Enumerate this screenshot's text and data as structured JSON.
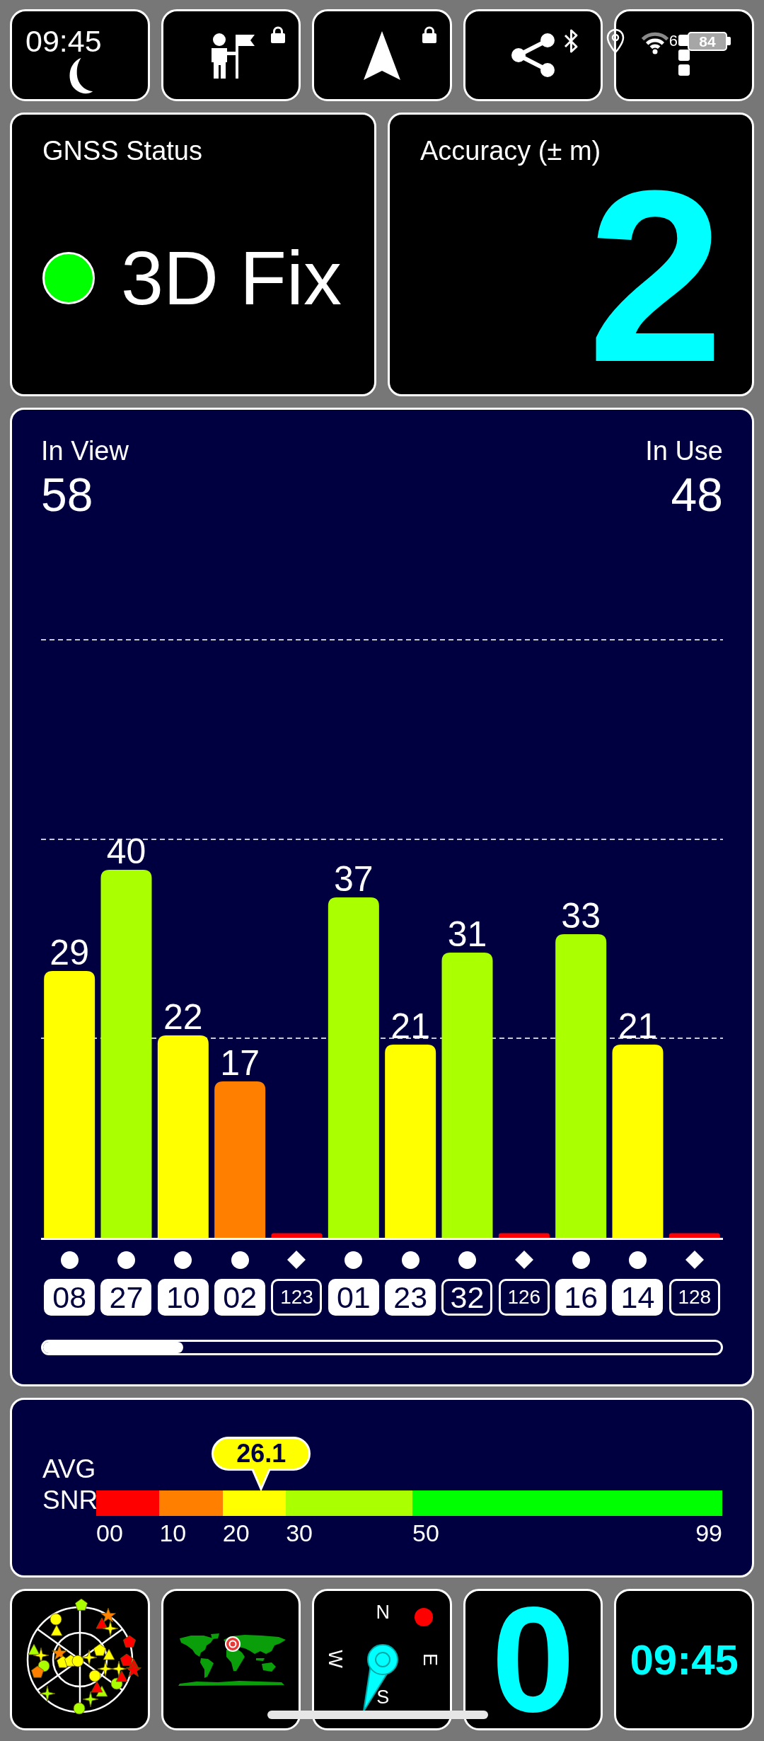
{
  "status_bar": {
    "time": "09:45",
    "wifi_label": "6",
    "battery": "84"
  },
  "top_tiles": [
    {
      "kind": "moon",
      "locked": false
    },
    {
      "kind": "person_flag",
      "locked": true
    },
    {
      "kind": "navigation",
      "locked": true
    },
    {
      "kind": "share",
      "locked": false
    },
    {
      "kind": "squares",
      "locked": false
    }
  ],
  "gnss_status": {
    "title": "GNSS Status",
    "value": "3D Fix",
    "color": "#00ff00"
  },
  "accuracy": {
    "title": "Accuracy (± m)",
    "value": "2"
  },
  "satellites": {
    "in_view_label": "In View",
    "in_view": "58",
    "in_use_label": "In Use",
    "in_use": "48",
    "chart_data": {
      "type": "bar",
      "categories": [
        "08",
        "27",
        "10",
        "02",
        "123",
        "01",
        "23",
        "32",
        "126",
        "16",
        "14",
        "128"
      ],
      "values": [
        29,
        40,
        22,
        17,
        0.5,
        37,
        21,
        31,
        0.5,
        33,
        21,
        0.5
      ],
      "value_labels": [
        "29",
        "40",
        "22",
        "17",
        null,
        "37",
        "21",
        "31",
        null,
        "33",
        "21",
        null
      ]
    },
    "markers": [
      {
        "kind": "circle",
        "used": true,
        "color": "#ffff00"
      },
      {
        "kind": "circle",
        "used": true,
        "color": "#aaff00"
      },
      {
        "kind": "circle",
        "used": true,
        "color": "#ffff00"
      },
      {
        "kind": "circle",
        "used": true,
        "color": "#ff8000"
      },
      {
        "kind": "diamond",
        "used": false,
        "color": "#ff0000"
      },
      {
        "kind": "circle",
        "used": true,
        "color": "#aaff00"
      },
      {
        "kind": "circle",
        "used": true,
        "color": "#ffff00"
      },
      {
        "kind": "circle",
        "used": false,
        "color": "#aaff00"
      },
      {
        "kind": "diamond",
        "used": false,
        "color": "#ff0000"
      },
      {
        "kind": "circle",
        "used": true,
        "color": "#aaff00"
      },
      {
        "kind": "circle",
        "used": true,
        "color": "#ffff00"
      },
      {
        "kind": "diamond",
        "used": false,
        "color": "#ff0000"
      }
    ]
  },
  "avg_snr": {
    "label": "AVG SNR",
    "reading": "26.1",
    "level": 0.2636,
    "segments": [
      {
        "color": "#ff0000"
      },
      {
        "color": "#ff8000"
      },
      {
        "color": "#ffff00"
      },
      {
        "color": "#aaff00"
      },
      {
        "color": "#00ff00"
      }
    ],
    "ticks": [
      "00",
      "10",
      "20",
      "30",
      "50",
      "99"
    ]
  },
  "bottom_tiles": [
    {
      "kind": "sky_plot"
    },
    {
      "kind": "world_map"
    },
    {
      "kind": "compass",
      "directions": [
        "N",
        "E",
        "S",
        "W"
      ]
    },
    {
      "kind": "number",
      "value": "0"
    },
    {
      "kind": "clock",
      "value": "09:45"
    }
  ]
}
